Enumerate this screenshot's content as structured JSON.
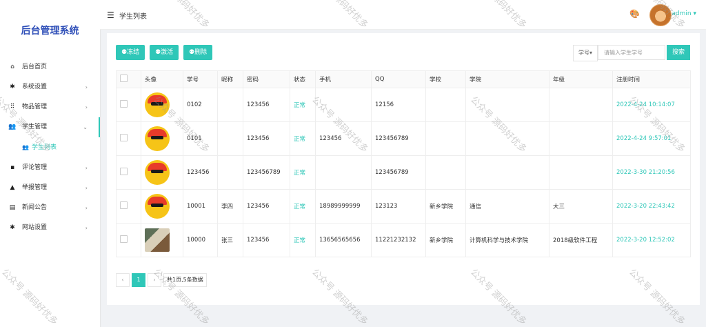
{
  "sidebar": {
    "title": "后台管理系统",
    "items": [
      {
        "label": "后台首页",
        "icon": "home-icon"
      },
      {
        "label": "系统设置",
        "icon": "gear-icon",
        "arrow": "›"
      },
      {
        "label": "物品管理",
        "icon": "grid-icon",
        "arrow": "›"
      },
      {
        "label": "学生管理",
        "icon": "users-icon",
        "arrow": "⌄"
      },
      {
        "label": "评论管理",
        "icon": "comment-icon",
        "arrow": "›"
      },
      {
        "label": "举报管理",
        "icon": "warning-icon",
        "arrow": "›"
      },
      {
        "label": "新闻公告",
        "icon": "news-icon",
        "arrow": "›"
      },
      {
        "label": "网站设置",
        "icon": "gear-icon",
        "arrow": "›"
      }
    ],
    "sub_item": "学生列表"
  },
  "header": {
    "page_title": "学生列表",
    "user": "admin ▾"
  },
  "toolbar": {
    "freeze": "冻结",
    "activate": "激活",
    "delete": "删除",
    "search_field": "学号▾",
    "search_placeholder": "请输入学生学号",
    "search_button": "搜索"
  },
  "table": {
    "headers": [
      "",
      "头像",
      "学号",
      "昵称",
      "密码",
      "状态",
      "手机",
      "QQ",
      "学校",
      "学院",
      "年级",
      "注册时间"
    ],
    "rows": [
      {
        "id": "0102",
        "nick": "",
        "pwd": "123456",
        "status": "正常",
        "phone": "",
        "qq": "12156",
        "school": "",
        "college": "",
        "grade": "",
        "time": "2022-4-24 10:14:07",
        "avatar": "helmet"
      },
      {
        "id": "0101",
        "nick": "",
        "pwd": "123456",
        "status": "正常",
        "phone": "123456",
        "qq": "123456789",
        "school": "",
        "college": "",
        "grade": "",
        "time": "2022-4-24 9:57:01",
        "avatar": "helmet"
      },
      {
        "id": "123456",
        "nick": "",
        "pwd": "123456789",
        "status": "正常",
        "phone": "",
        "qq": "123456789",
        "school": "",
        "college": "",
        "grade": "",
        "time": "2022-3-30 21:20:56",
        "avatar": "helmet"
      },
      {
        "id": "10001",
        "nick": "李四",
        "pwd": "123456",
        "status": "正常",
        "phone": "18989999999",
        "qq": "123123",
        "school": "新乡学院",
        "college": "通信",
        "grade": "大三",
        "time": "2022-3-20 22:43:42",
        "avatar": "helmet"
      },
      {
        "id": "10000",
        "nick": "张三",
        "pwd": "123456",
        "status": "正常",
        "phone": "13656565656",
        "qq": "11221232132",
        "school": "新乡学院",
        "college": "计算机科学与技术学院",
        "grade": "2018级软件工程",
        "time": "2022-3-20 12:52:02",
        "avatar": "photo"
      }
    ]
  },
  "pagination": {
    "prev": "‹",
    "current": "1",
    "next": "›",
    "info": "共1页,5条数据"
  },
  "watermark": "公众号 源码好优多"
}
